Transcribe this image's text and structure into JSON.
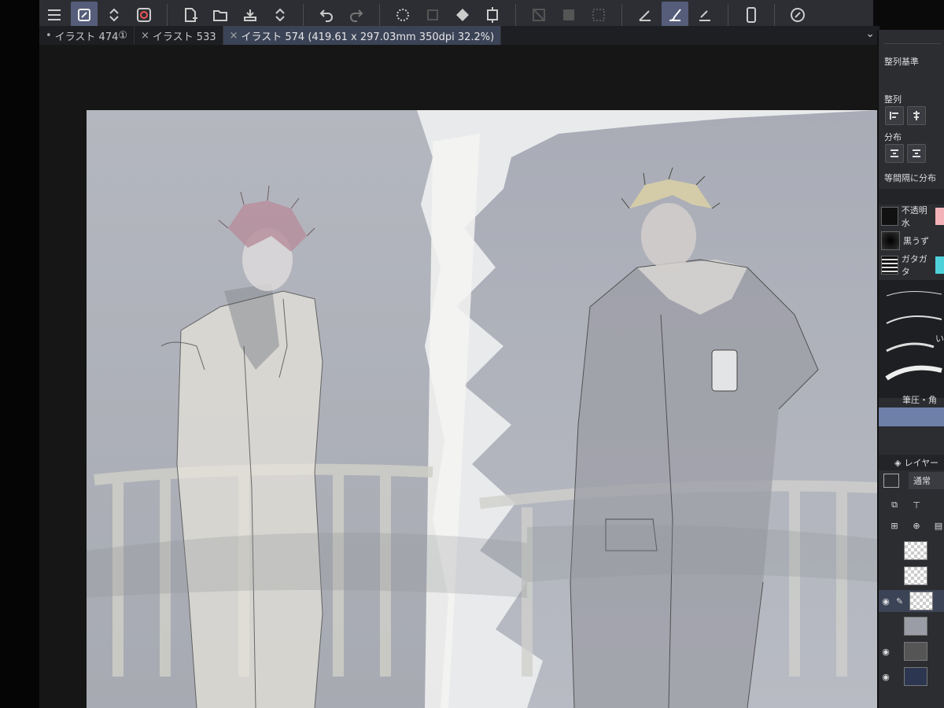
{
  "toolbar": {
    "icons": [
      "menu-icon",
      "brush-settings-icon",
      "swap-icon",
      "clip-studio-logo-icon",
      "new-file-icon",
      "open-folder-icon",
      "save-icon",
      "stepper-icon",
      "undo-icon",
      "redo-icon",
      "loading-icon",
      "selection-icon",
      "fill-icon",
      "transform-icon",
      "clear-icon",
      "gradient-icon",
      "clipping-icon",
      "pen-tool-icon",
      "brush-tool-icon",
      "eraser-tool-icon",
      "smartphone-icon",
      "companion-icon"
    ]
  },
  "tabs": [
    {
      "label": "イラスト 474",
      "prefix": "•",
      "suffix": "①"
    },
    {
      "label": "イラスト 533",
      "prefix": "×"
    },
    {
      "label": "イラスト 574 (419.61 x 297.03mm 350dpi 32.2%)",
      "prefix": "×"
    }
  ],
  "right_panel": {
    "align_base_label": "整列基準",
    "align_label": "整列",
    "distribute_label": "分布",
    "equal_spacing_label": "等間隔に分布",
    "brushes": [
      {
        "label": "不透明水"
      },
      {
        "label": "黒うず"
      },
      {
        "label": "ガタガタ"
      }
    ],
    "brush_size_labels": [
      "ー",
      "い"
    ],
    "pressure_label": "筆圧・角度",
    "layer_tab_label": "レイヤー",
    "blend_mode": "通常",
    "colors": {
      "accent_blue": "#555d7a",
      "selected_swatch": "#6e7fa8",
      "pink_swatch": "#f2b3b8",
      "cyan_swatch": "#4fd1d9"
    }
  }
}
